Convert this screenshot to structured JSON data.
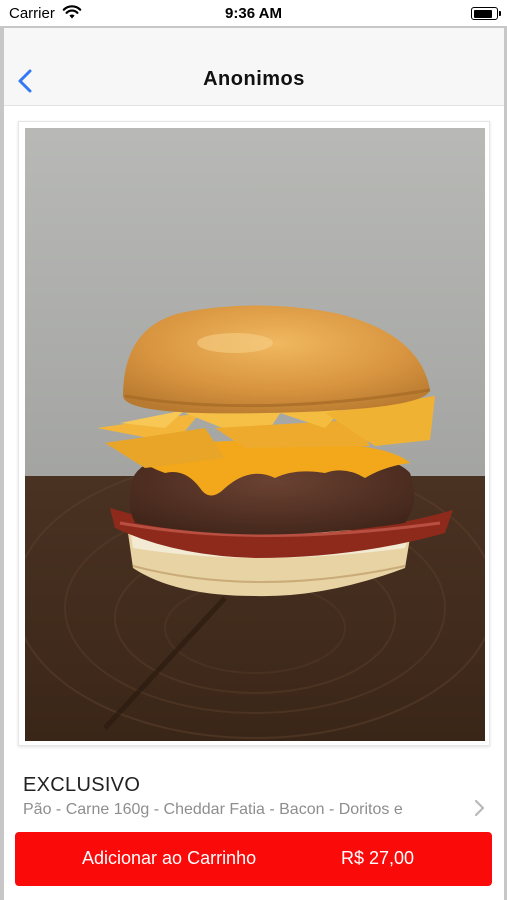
{
  "status_bar": {
    "carrier": "Carrier",
    "time": "9:36 AM",
    "icons": [
      "wifi-icon",
      "battery-icon"
    ],
    "battery_level": 0.85
  },
  "nav": {
    "title": "Anonimos",
    "back_icon": "chevron-left-icon"
  },
  "product": {
    "image_subject": "burger-photo",
    "name": "EXCLUSIVO",
    "description": "Pão - Carne 160g - Cheddar Fatia - Bacon - Doritos e",
    "detail_icon": "chevron-right-icon"
  },
  "cart_button": {
    "label": "Adicionar ao Carrinho",
    "price": "R$ 27,00"
  },
  "colors": {
    "accent": "#fb0a0a",
    "back_tint": "#3478f6",
    "nav_background": "#f7f7f7",
    "description_text": "#8e8e8e"
  }
}
